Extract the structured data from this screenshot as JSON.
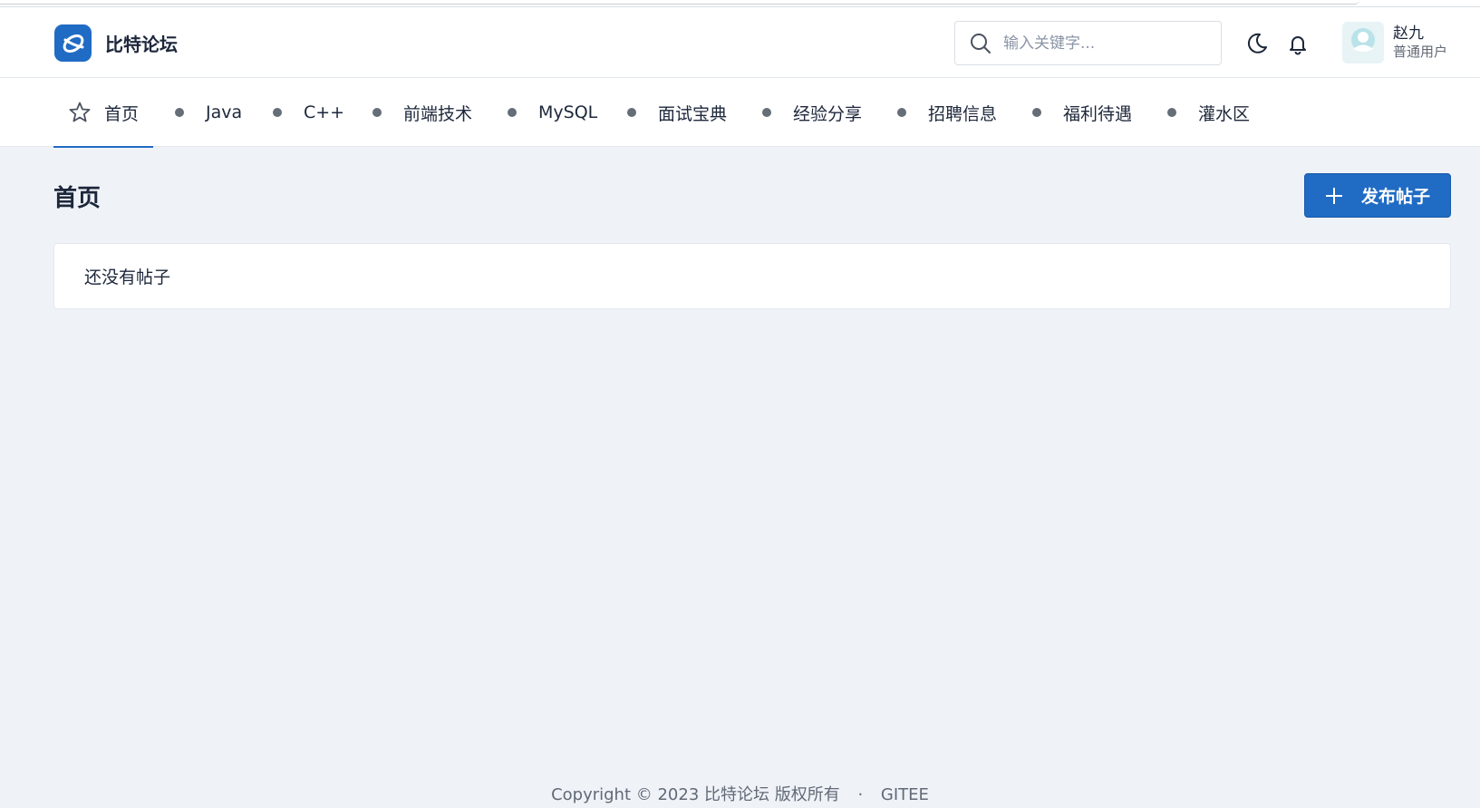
{
  "brand": {
    "name": "比特论坛"
  },
  "search": {
    "placeholder": "输入关键字..."
  },
  "user": {
    "name": "赵九",
    "role": "普通用户"
  },
  "nav": {
    "home": "首页",
    "items": [
      {
        "label": "Java"
      },
      {
        "label": "C++"
      },
      {
        "label": "前端技术"
      },
      {
        "label": "MySQL"
      },
      {
        "label": "面试宝典"
      },
      {
        "label": "经验分享"
      },
      {
        "label": "招聘信息"
      },
      {
        "label": "福利待遇"
      },
      {
        "label": "灌水区"
      }
    ]
  },
  "main": {
    "title": "首页",
    "publish_label": "发布帖子",
    "empty_text": "还没有帖子"
  },
  "footer": {
    "copyright": "Copyright © 2023 比特论坛 版权所有",
    "separator": "·",
    "link": "GITEE"
  },
  "colors": {
    "accent": "#206bc4",
    "background": "#eff3f8"
  },
  "icons": [
    "brand-logo-icon",
    "search-icon",
    "moon-icon",
    "bell-icon",
    "avatar-icon",
    "star-icon",
    "plus-icon"
  ]
}
